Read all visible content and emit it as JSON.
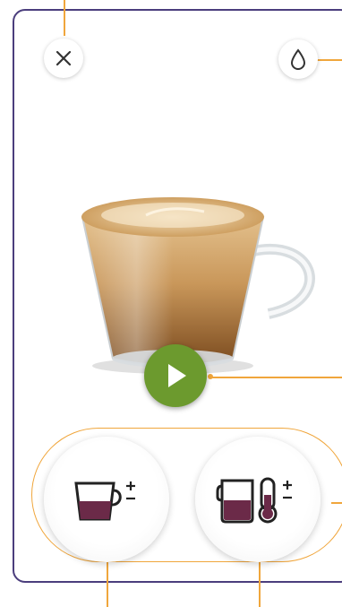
{
  "screen": {
    "close_icon": "close-icon",
    "water_icon": "water-drop-icon",
    "play_icon": "play-icon"
  },
  "beverage": {
    "image": "cappuccino-cup",
    "volume_button_icon": "cup-volume-plus-minus-icon",
    "milk_temp_button_icon": "milk-jug-thermometer-plus-minus-icon"
  },
  "colors": {
    "frame": "#4b3e7d",
    "annotation": "#f0a63c",
    "play_button": "#6c9a2e",
    "icon_fill": "#6b2a48"
  }
}
